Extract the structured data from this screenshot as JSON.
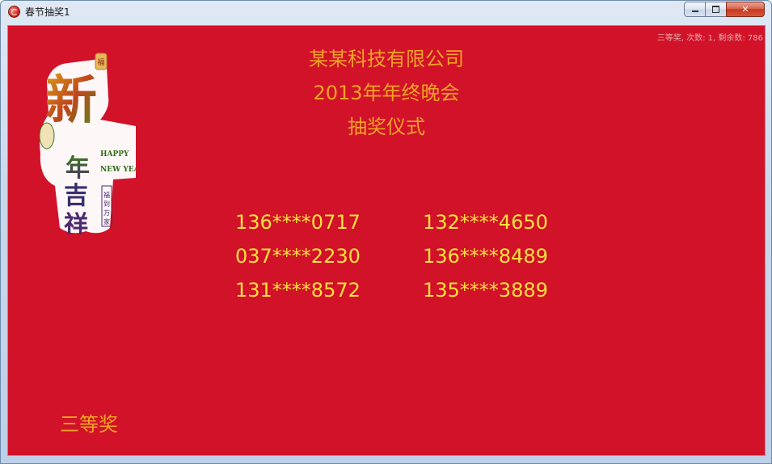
{
  "window": {
    "title": "春节抽奖1",
    "close_glyph": "✕"
  },
  "status_text": "三等奖, 次数: 1, 剩余数: 786",
  "headings": [
    "某某科技有限公司",
    "2013年年终晚会",
    "抽奖仪式"
  ],
  "winners": {
    "left": [
      "136****0717",
      "037****2230",
      "131****8572"
    ],
    "right": [
      "132****4650",
      "136****8489",
      "135****3889"
    ]
  },
  "prize_level": "三等奖",
  "logo": {
    "big_char": "新",
    "main_text": "年吉祥",
    "english_line1": "HAPPY",
    "english_line2": "NEW YEAR",
    "side_text": "福到万家",
    "seal_text": "福"
  },
  "colors": {
    "background": "#d21228",
    "heading": "#f0a326",
    "winner": "#ffe23c"
  }
}
